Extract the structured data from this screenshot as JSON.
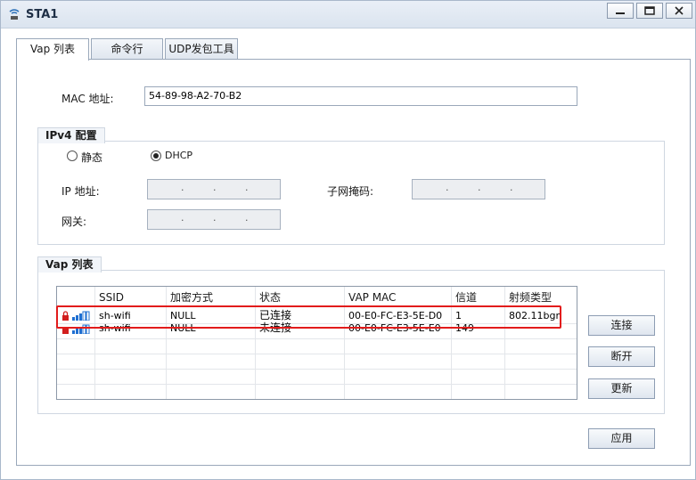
{
  "window": {
    "title": "STA1"
  },
  "tabs": [
    {
      "label": "Vap 列表"
    },
    {
      "label": "命令行"
    },
    {
      "label": "UDP发包工具"
    }
  ],
  "mac": {
    "label": "MAC 地址:",
    "value": "54-89-98-A2-70-B2"
  },
  "ipv4": {
    "group_title": "IPv4 配置",
    "static_label": "静态",
    "dhcp_label": "DHCP",
    "selected": "DHCP",
    "ip_label": "IP 地址:",
    "mask_label": "子网掩码:",
    "gateway_label": "网关:",
    "ip_dot": "."
  },
  "vap": {
    "group_title": "Vap 列表",
    "columns": [
      "SSID",
      "加密方式",
      "状态",
      "VAP MAC",
      "信道",
      "射频类型"
    ],
    "rows": [
      {
        "ssid": "sh-wifi",
        "encryption": "NULL",
        "status": "已连接",
        "mac": "00-E0-FC-E3-5E-D0",
        "channel": "1",
        "radio": "802.11bgn"
      },
      {
        "ssid": "sh-wifi",
        "encryption": "NULL",
        "status": "未连接",
        "mac": "00-E0-FC-E3-5E-E0",
        "channel": "149",
        "radio": ""
      }
    ]
  },
  "buttons": {
    "connect": "连接",
    "disconnect": "断开",
    "refresh": "更新",
    "apply": "应用"
  },
  "colors": {
    "highlight": "#e21b1b",
    "signal": "#1f6fd1",
    "lock": "#d21f1f"
  }
}
